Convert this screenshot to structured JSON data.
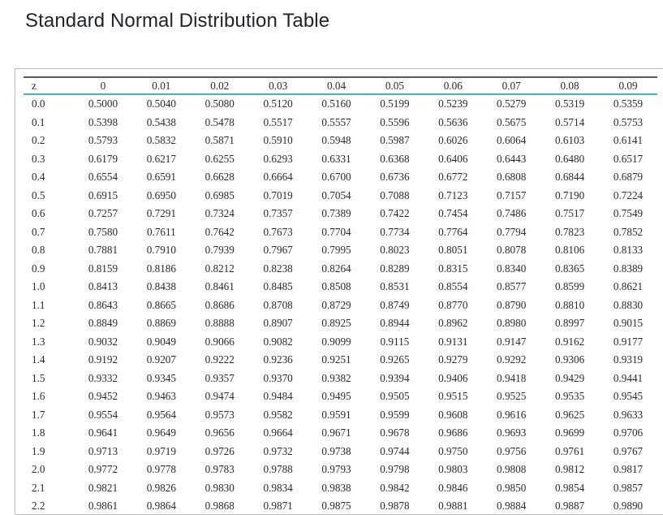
{
  "title": "Standard Normal Distribution Table",
  "table": {
    "headers": [
      "z",
      "0",
      "0.01",
      "0.02",
      "0.03",
      "0.04",
      "0.05",
      "0.06",
      "0.07",
      "0.08",
      "0.09"
    ],
    "rows": [
      {
        "z": "0.0",
        "values": [
          "0.5000",
          "0.5040",
          "0.5080",
          "0.5120",
          "0.5160",
          "0.5199",
          "0.5239",
          "0.5279",
          "0.5319",
          "0.5359"
        ]
      },
      {
        "z": "0.1",
        "values": [
          "0.5398",
          "0.5438",
          "0.5478",
          "0.5517",
          "0.5557",
          "0.5596",
          "0.5636",
          "0.5675",
          "0.5714",
          "0.5753"
        ]
      },
      {
        "z": "0.2",
        "values": [
          "0.5793",
          "0.5832",
          "0.5871",
          "0.5910",
          "0.5948",
          "0.5987",
          "0.6026",
          "0.6064",
          "0.6103",
          "0.6141"
        ]
      },
      {
        "z": "0.3",
        "values": [
          "0.6179",
          "0.6217",
          "0.6255",
          "0.6293",
          "0.6331",
          "0.6368",
          "0.6406",
          "0.6443",
          "0.6480",
          "0.6517"
        ]
      },
      {
        "z": "0.4",
        "values": [
          "0.6554",
          "0.6591",
          "0.6628",
          "0.6664",
          "0.6700",
          "0.6736",
          "0.6772",
          "0.6808",
          "0.6844",
          "0.6879"
        ]
      },
      {
        "z": "0.5",
        "values": [
          "0.6915",
          "0.6950",
          "0.6985",
          "0.7019",
          "0.7054",
          "0.7088",
          "0.7123",
          "0.7157",
          "0.7190",
          "0.7224"
        ]
      },
      {
        "z": "0.6",
        "values": [
          "0.7257",
          "0.7291",
          "0.7324",
          "0.7357",
          "0.7389",
          "0.7422",
          "0.7454",
          "0.7486",
          "0.7517",
          "0.7549"
        ]
      },
      {
        "z": "0.7",
        "values": [
          "0.7580",
          "0.7611",
          "0.7642",
          "0.7673",
          "0.7704",
          "0.7734",
          "0.7764",
          "0.7794",
          "0.7823",
          "0.7852"
        ]
      },
      {
        "z": "0.8",
        "values": [
          "0.7881",
          "0.7910",
          "0.7939",
          "0.7967",
          "0.7995",
          "0.8023",
          "0.8051",
          "0.8078",
          "0.8106",
          "0.8133"
        ]
      },
      {
        "z": "0.9",
        "values": [
          "0.8159",
          "0.8186",
          "0.8212",
          "0.8238",
          "0.8264",
          "0.8289",
          "0.8315",
          "0.8340",
          "0.8365",
          "0.8389"
        ]
      },
      {
        "z": "1.0",
        "values": [
          "0.8413",
          "0.8438",
          "0.8461",
          "0.8485",
          "0.8508",
          "0.8531",
          "0.8554",
          "0.8577",
          "0.8599",
          "0.8621"
        ]
      },
      {
        "z": "1.1",
        "values": [
          "0.8643",
          "0.8665",
          "0.8686",
          "0.8708",
          "0.8729",
          "0.8749",
          "0.8770",
          "0.8790",
          "0.8810",
          "0.8830"
        ]
      },
      {
        "z": "1.2",
        "values": [
          "0.8849",
          "0.8869",
          "0.8888",
          "0.8907",
          "0.8925",
          "0.8944",
          "0.8962",
          "0.8980",
          "0.8997",
          "0.9015"
        ]
      },
      {
        "z": "1.3",
        "values": [
          "0.9032",
          "0.9049",
          "0.9066",
          "0.9082",
          "0.9099",
          "0.9115",
          "0.9131",
          "0.9147",
          "0.9162",
          "0.9177"
        ]
      },
      {
        "z": "1.4",
        "values": [
          "0.9192",
          "0.9207",
          "0.9222",
          "0.9236",
          "0.9251",
          "0.9265",
          "0.9279",
          "0.9292",
          "0.9306",
          "0.9319"
        ]
      },
      {
        "z": "1.5",
        "values": [
          "0.9332",
          "0.9345",
          "0.9357",
          "0.9370",
          "0.9382",
          "0.9394",
          "0.9406",
          "0.9418",
          "0.9429",
          "0.9441"
        ]
      },
      {
        "z": "1.6",
        "values": [
          "0.9452",
          "0.9463",
          "0.9474",
          "0.9484",
          "0.9495",
          "0.9505",
          "0.9515",
          "0.9525",
          "0.9535",
          "0.9545"
        ]
      },
      {
        "z": "1.7",
        "values": [
          "0.9554",
          "0.9564",
          "0.9573",
          "0.9582",
          "0.9591",
          "0.9599",
          "0.9608",
          "0.9616",
          "0.9625",
          "0.9633"
        ]
      },
      {
        "z": "1.8",
        "values": [
          "0.9641",
          "0.9649",
          "0.9656",
          "0.9664",
          "0.9671",
          "0.9678",
          "0.9686",
          "0.9693",
          "0.9699",
          "0.9706"
        ]
      },
      {
        "z": "1.9",
        "values": [
          "0.9713",
          "0.9719",
          "0.9726",
          "0.9732",
          "0.9738",
          "0.9744",
          "0.9750",
          "0.9756",
          "0.9761",
          "0.9767"
        ]
      },
      {
        "z": "2.0",
        "values": [
          "0.9772",
          "0.9778",
          "0.9783",
          "0.9788",
          "0.9793",
          "0.9798",
          "0.9803",
          "0.9808",
          "0.9812",
          "0.9817"
        ]
      },
      {
        "z": "2.1",
        "values": [
          "0.9821",
          "0.9826",
          "0.9830",
          "0.9834",
          "0.9838",
          "0.9842",
          "0.9846",
          "0.9850",
          "0.9854",
          "0.9857"
        ]
      },
      {
        "z": "2.2",
        "values": [
          "0.9861",
          "0.9864",
          "0.9868",
          "0.9871",
          "0.9875",
          "0.9878",
          "0.9881",
          "0.9884",
          "0.9887",
          "0.9890"
        ]
      }
    ]
  }
}
